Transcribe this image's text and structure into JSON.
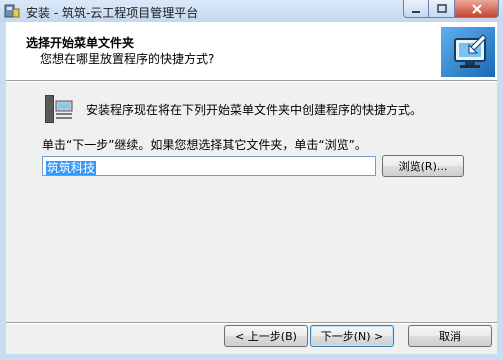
{
  "window": {
    "title": "安装 - 筑筑-云工程项目管理平台",
    "controls": {
      "minimize": "minimize",
      "maximize": "maximize",
      "close": "close"
    }
  },
  "header": {
    "title": "选择开始菜单文件夹",
    "subtitle": "您想在哪里放置程序的快捷方式?"
  },
  "body": {
    "info_text": "安装程序现在将在下列开始菜单文件夹中创建程序的快捷方式。",
    "instruction_text": "单击“下一步”继续。如果您想选择其它文件夹，单击“浏览”。",
    "folder_value": "筑筑科技",
    "browse_label": "浏览(R)..."
  },
  "footer": {
    "back_label": "< 上一步(B)",
    "next_label": "下一步(N) >",
    "cancel_label": "取消"
  },
  "colors": {
    "titlebar": "#c3d7ef",
    "close_button": "#c6452f",
    "selection": "#3399ff",
    "header_band": "#ffffff",
    "dialog_bg": "#f0f0f0"
  },
  "icons": [
    "installer-app-icon",
    "wizard-monitor-image",
    "start-menu-folder-icon"
  ]
}
